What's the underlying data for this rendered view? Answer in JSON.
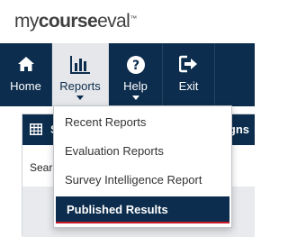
{
  "brand": {
    "part1": "my",
    "part2": "course",
    "part3": "eval",
    "tm": "™"
  },
  "nav": {
    "home": {
      "label": "Home",
      "icon": "home-icon"
    },
    "reports": {
      "label": "Reports",
      "icon": "bar-chart-icon"
    },
    "help": {
      "label": "Help",
      "icon": "question-circle-icon"
    },
    "exit": {
      "label": "Exit",
      "icon": "sign-out-icon"
    }
  },
  "panel": {
    "title_fragment": "S",
    "title_right": "gns",
    "search_label": "Sear"
  },
  "reports_menu": {
    "items": [
      {
        "label": "Recent Reports"
      },
      {
        "label": "Evaluation Reports"
      },
      {
        "label": "Survey Intelligence Report"
      },
      {
        "label": "Published Results"
      }
    ],
    "selected": "Published Results"
  },
  "colors": {
    "navy": "#0c2d4d",
    "active_tab_bg": "#e5e7ea",
    "selected_underline": "#c9182b"
  }
}
